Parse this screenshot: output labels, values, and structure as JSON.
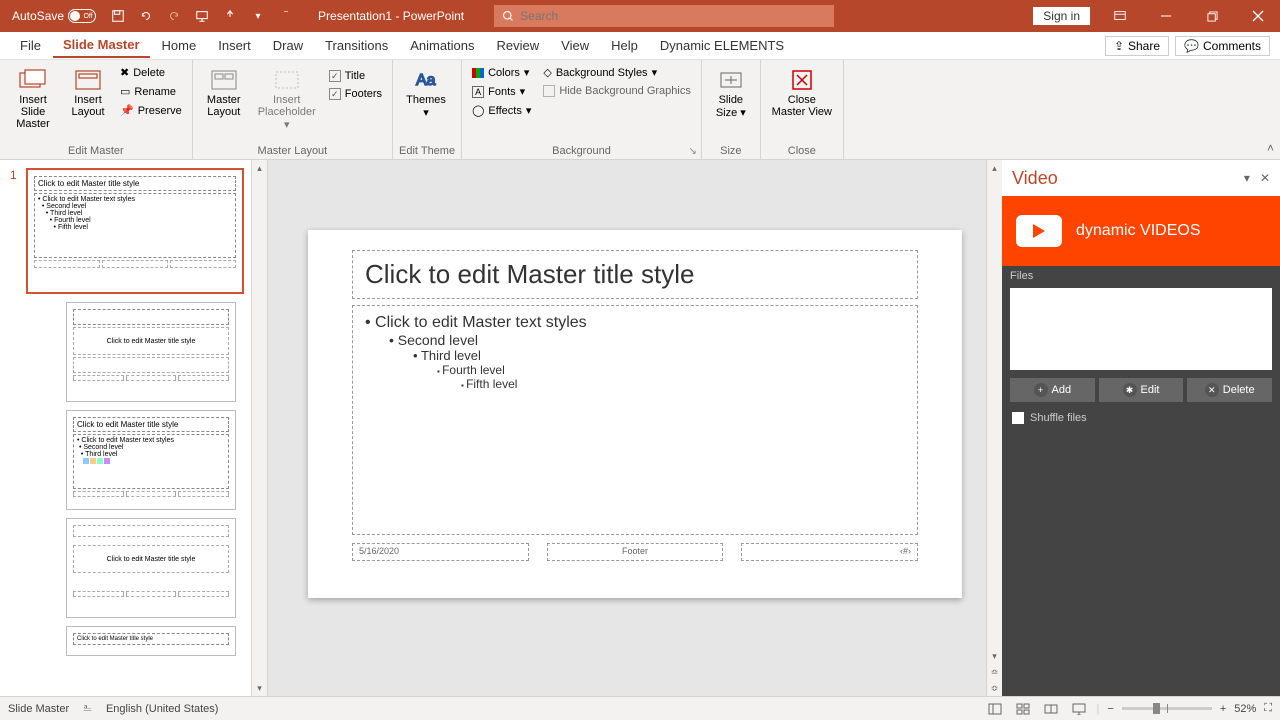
{
  "titlebar": {
    "autosave_label": "AutoSave",
    "autosave_state": "Off",
    "doc_title": "Presentation1 - PowerPoint",
    "search_placeholder": "Search",
    "signin": "Sign in"
  },
  "menu": {
    "tabs": [
      "File",
      "Slide Master",
      "Home",
      "Insert",
      "Draw",
      "Transitions",
      "Animations",
      "Review",
      "View",
      "Help",
      "Dynamic ELEMENTS"
    ],
    "active": 1,
    "share": "Share",
    "comments": "Comments"
  },
  "ribbon": {
    "edit_master": {
      "label": "Edit Master",
      "insert_slide_master": "Insert Slide\nMaster",
      "insert_layout": "Insert\nLayout",
      "delete": "Delete",
      "rename": "Rename",
      "preserve": "Preserve"
    },
    "master_layout": {
      "label": "Master Layout",
      "master_layout_btn": "Master\nLayout",
      "insert_placeholder": "Insert\nPlaceholder",
      "title": "Title",
      "footers": "Footers"
    },
    "edit_theme": {
      "label": "Edit Theme",
      "themes": "Themes"
    },
    "background": {
      "label": "Background",
      "colors": "Colors",
      "fonts": "Fonts",
      "effects": "Effects",
      "bg_styles": "Background Styles",
      "hide_bg": "Hide Background Graphics"
    },
    "size": {
      "label": "Size",
      "slide_size": "Slide\nSize"
    },
    "close": {
      "label": "Close",
      "close_master": "Close\nMaster View"
    }
  },
  "slide": {
    "title": "Click to edit Master title style",
    "body_l1": "Click to edit Master text styles",
    "body_l2": "Second level",
    "body_l3": "Third level",
    "body_l4": "Fourth level",
    "body_l5": "Fifth level",
    "date": "5/16/2020",
    "footer": "Footer",
    "pagenum": "‹#›"
  },
  "thumbs": {
    "num": "1",
    "layout_title": "Click to edit Master title style",
    "layout_small_title": "Click to edit Master title style"
  },
  "video": {
    "header": "Video",
    "banner": "dynamic VIDEOS",
    "files": "Files",
    "add": "Add",
    "edit": "Edit",
    "delete": "Delete",
    "shuffle": "Shuffle files"
  },
  "status": {
    "mode": "Slide Master",
    "lang": "English (United States)",
    "zoom": "52%"
  }
}
